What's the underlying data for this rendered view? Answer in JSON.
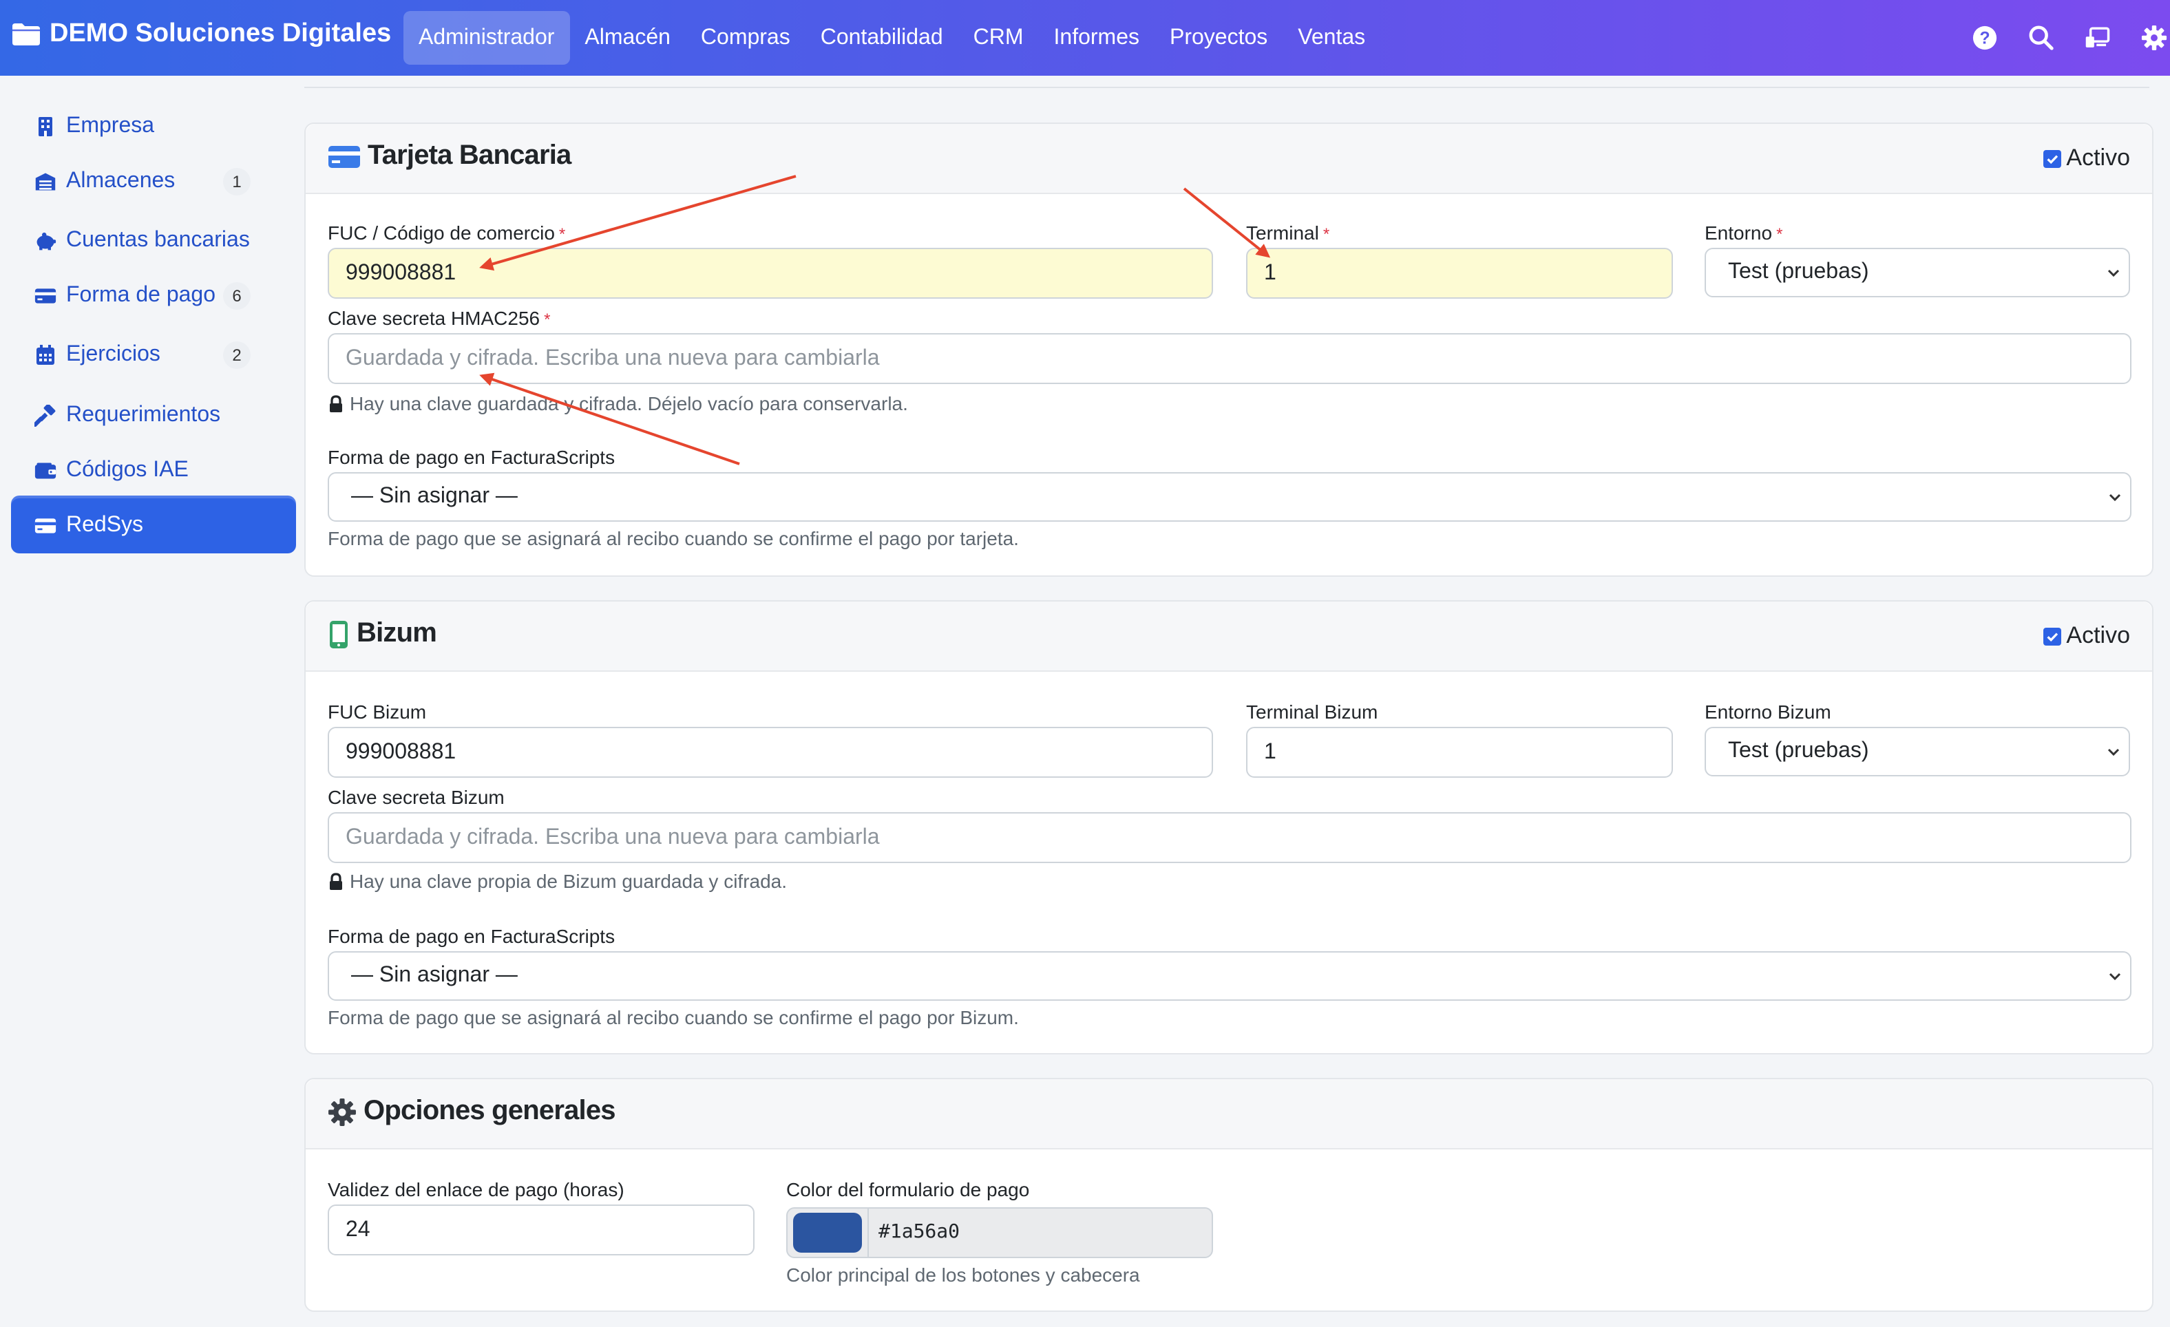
{
  "topbar": {
    "brand": "DEMO Soluciones Digitales",
    "menu": [
      "Administrador",
      "Almacén",
      "Compras",
      "Contabilidad",
      "CRM",
      "Informes",
      "Proyectos",
      "Ventas"
    ],
    "active_menu": "Administrador",
    "icons": [
      "help-icon",
      "search-icon",
      "screen-share-icon",
      "gear-icon"
    ]
  },
  "sidebar": {
    "items": [
      {
        "label": "Empresa",
        "icon": "building-icon"
      },
      {
        "label": "Almacenes",
        "icon": "warehouse-icon",
        "badge": "1"
      },
      {
        "label": "Cuentas bancarias",
        "icon": "piggy-bank-icon"
      },
      {
        "label": "Forma de pago",
        "icon": "credit-card-icon",
        "badge": "6"
      },
      {
        "label": "Ejercicios",
        "icon": "calendar-icon",
        "badge": "2"
      },
      {
        "label": "Requerimientos",
        "icon": "hammer-icon"
      },
      {
        "label": "Códigos IAE",
        "icon": "wallet-icon"
      },
      {
        "label": "RedSys",
        "icon": "credit-card-icon",
        "active": true
      }
    ]
  },
  "tarjeta": {
    "title": "Tarjeta Bancaria",
    "activo_label": "Activo",
    "activo_checked": true,
    "fuc_label": "FUC / Código de comercio",
    "fuc_value": "999008881",
    "terminal_label": "Terminal",
    "terminal_value": "1",
    "entorno_label": "Entorno",
    "entorno_value": "Test (pruebas)",
    "clave_label": "Clave secreta HMAC256",
    "clave_placeholder": "Guardada y cifrada. Escriba una nueva para cambiarla",
    "clave_help": "Hay una clave guardada y cifrada. Déjelo vacío para conservarla.",
    "forma_label": "Forma de pago en FacturaScripts",
    "forma_value": "— Sin asignar —",
    "forma_help": "Forma de pago que se asignará al recibo cuando se confirme el pago por tarjeta.",
    "required_mark": "*"
  },
  "bizum": {
    "title": "Bizum",
    "activo_label": "Activo",
    "activo_checked": true,
    "fuc_label": "FUC Bizum",
    "fuc_value": "999008881",
    "terminal_label": "Terminal Bizum",
    "terminal_value": "1",
    "entorno_label": "Entorno Bizum",
    "entorno_value": "Test (pruebas)",
    "clave_label": "Clave secreta Bizum",
    "clave_placeholder": "Guardada y cifrada. Escriba una nueva para cambiarla",
    "clave_help": "Hay una clave propia de Bizum guardada y cifrada.",
    "forma_label": "Forma de pago en FacturaScripts",
    "forma_value": "— Sin asignar —",
    "forma_help": "Forma de pago que se asignará al recibo cuando se confirme el pago por Bizum."
  },
  "opciones": {
    "title": "Opciones generales",
    "validez_label": "Validez del enlace de pago (horas)",
    "validez_value": "24",
    "color_label": "Color del formulario de pago",
    "color_value": "#1a56a0",
    "color_help": "Color principal de los botones y cabecera"
  },
  "colors": {
    "accent": "#2d62e5",
    "required": "#dc3545",
    "highlight_input": "#fdfbd3",
    "annotation_arrow": "#e5452e",
    "swatch": "#2b55a0"
  }
}
